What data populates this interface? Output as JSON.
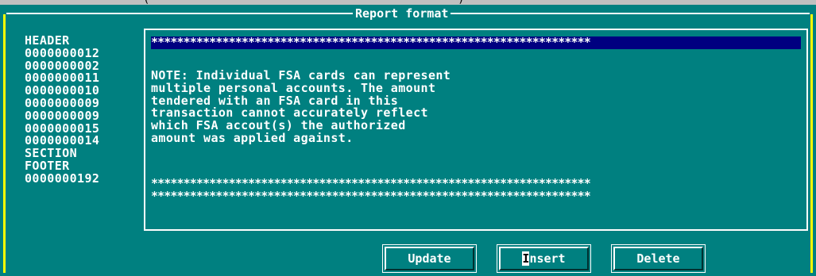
{
  "top_strip_text": "(                                              )",
  "frame": {
    "title": "Report format"
  },
  "left_list": [
    "HEADER",
    "0000000012",
    "0000000002",
    "0000000011",
    "0000000010",
    "0000000009",
    "0000000009",
    "0000000015",
    "0000000014",
    "SECTION",
    "FOOTER",
    "0000000192"
  ],
  "editor": {
    "line_selected": "********************************************************************",
    "note_lines": [
      "NOTE: Individual FSA cards can represent",
      "multiple personal accounts. The amount",
      "tendered with an FSA card in this",
      "transaction cannot accurately reflect",
      "which FSA accout(s) the authorized",
      "amount was applied against."
    ],
    "stars_line_1": "********************************************************************",
    "stars_line_2": "********************************************************************"
  },
  "buttons": {
    "update": "Update",
    "insert_hotkey": "I",
    "insert_rest": "nsert",
    "delete": "Delete"
  },
  "colors": {
    "background": "#008080",
    "selection": "#000080",
    "frame_border": "#ffff00",
    "text": "#ffffff"
  }
}
